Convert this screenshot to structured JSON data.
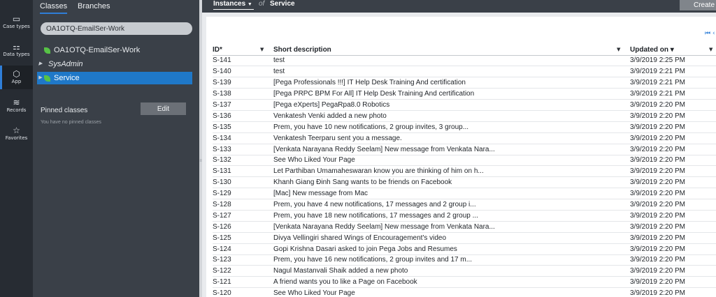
{
  "rail": [
    {
      "icon": "▭",
      "label": "Case types"
    },
    {
      "icon": "⚏",
      "label": "Data types"
    },
    {
      "icon": "⬡",
      "label": "App"
    },
    {
      "icon": "≋",
      "label": "Records"
    },
    {
      "icon": "☆",
      "label": "Favorites"
    }
  ],
  "explorer": {
    "tabs": [
      "Classes",
      "Branches"
    ],
    "search_value": "OA1OTQ-EmailSer-Work",
    "tree": [
      "OA1OTQ-EmailSer-Work",
      "SysAdmin",
      "Service"
    ],
    "pinned_label": "Pinned classes",
    "edit_label": "Edit",
    "pinned_note": "You have no pinned classes"
  },
  "header": {
    "instances": "Instances",
    "of": "of",
    "class_name": "Service",
    "create": "Create"
  },
  "pager": "⏮ ‹",
  "columns": [
    "ID*",
    "Short description",
    "Updated on ▾"
  ],
  "rows": [
    [
      "S-141",
      "test",
      "3/9/2019 2:25 PM"
    ],
    [
      "S-140",
      "test",
      "3/9/2019 2:21 PM"
    ],
    [
      "S-139",
      "[Pega Professionals !!!] IT Help Desk Training And certification",
      "3/9/2019 2:21 PM"
    ],
    [
      "S-138",
      "[Pega PRPC BPM For All] IT Help Desk Training And certification",
      "3/9/2019 2:21 PM"
    ],
    [
      "S-137",
      "[Pega eXperts] PegaRpa8.0 Robotics",
      "3/9/2019 2:20 PM"
    ],
    [
      "S-136",
      "Venkatesh Venki added a new photo",
      "3/9/2019 2:20 PM"
    ],
    [
      "S-135",
      "Prem, you have 10 new notifications, 2 group invites, 3 group...",
      "3/9/2019 2:20 PM"
    ],
    [
      "S-134",
      "Venkatesh Teerparu sent you a message.",
      "3/9/2019 2:20 PM"
    ],
    [
      "S-133",
      "[Venkata Narayana Reddy Seelam] New message from Venkata Nara...",
      "3/9/2019 2:20 PM"
    ],
    [
      "S-132",
      "See Who Liked Your Page",
      "3/9/2019 2:20 PM"
    ],
    [
      "S-131",
      "Let Parthiban Umamaheswaran know you are thinking of him on h...",
      "3/9/2019 2:20 PM"
    ],
    [
      "S-130",
      "Khanh Giang Đinh Sang wants to be friends on Facebook",
      "3/9/2019 2:20 PM"
    ],
    [
      "S-129",
      "[Mac] New message from Mac",
      "3/9/2019 2:20 PM"
    ],
    [
      "S-128",
      "Prem, you have 4 new notifications, 17 messages and 2 group i...",
      "3/9/2019 2:20 PM"
    ],
    [
      "S-127",
      "Prem, you have 18 new notifications, 17 messages and 2 group ...",
      "3/9/2019 2:20 PM"
    ],
    [
      "S-126",
      "[Venkata Narayana Reddy Seelam] New message from Venkata Nara...",
      "3/9/2019 2:20 PM"
    ],
    [
      "S-125",
      "Divya Vellingiri shared Wings of Encouragement's video",
      "3/9/2019 2:20 PM"
    ],
    [
      "S-124",
      "Gopi Krishna Dasari asked to join Pega Jobs and Resumes",
      "3/9/2019 2:20 PM"
    ],
    [
      "S-123",
      "Prem, you have 16 new notifications, 2 group invites and 17 m...",
      "3/9/2019 2:20 PM"
    ],
    [
      "S-122",
      "Nagul Mastanvali Shaik added a new photo",
      "3/9/2019 2:20 PM"
    ],
    [
      "S-121",
      "A friend wants you to like a Page on Facebook",
      "3/9/2019 2:20 PM"
    ],
    [
      "S-120",
      "See Who Liked Your Page",
      "3/9/2019 2:20 PM"
    ]
  ]
}
